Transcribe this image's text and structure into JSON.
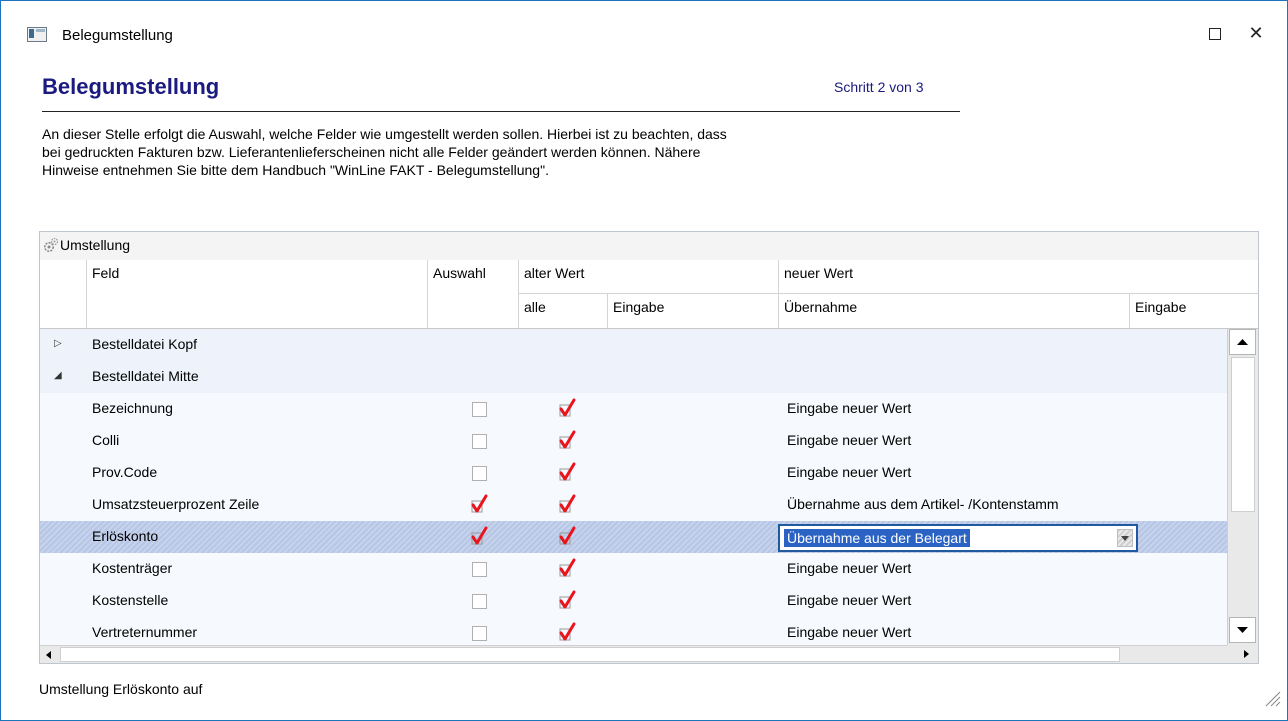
{
  "window": {
    "title": "Belegumstellung"
  },
  "header": {
    "title": "Belegumstellung",
    "step": "Schritt 2 von 3",
    "intro_lines": [
      "An dieser Stelle erfolgt die Auswahl, welche Felder wie umgestellt werden sollen. Hierbei ist zu beachten, dass",
      "bei gedruckten Fakturen bzw. Lieferantenlieferscheinen nicht alle Felder geändert werden können. Nähere",
      "Hinweise entnehmen Sie bitte dem Handbuch \"WinLine FAKT - Belegumstellung\"."
    ]
  },
  "grid": {
    "title": "Umstellung",
    "columns": {
      "feld": "Feld",
      "auswahl": "Auswahl",
      "alter_wert": "alter Wert",
      "alle": "alle",
      "eingabe_alt": "Eingabe",
      "neuer_wert": "neuer Wert",
      "uebernahme": "Übernahme",
      "eingabe_neu": "Eingabe"
    },
    "rows": [
      {
        "type": "group",
        "label": "Bestelldatei Kopf",
        "expanded": false
      },
      {
        "type": "group",
        "label": "Bestelldatei Mitte",
        "expanded": true
      },
      {
        "type": "item",
        "label": "Bezeichnung",
        "auswahl": false,
        "alle": true,
        "uebernahme": "Eingabe neuer Wert"
      },
      {
        "type": "item",
        "label": "Colli",
        "auswahl": false,
        "alle": true,
        "uebernahme": "Eingabe neuer Wert"
      },
      {
        "type": "item",
        "label": "Prov.Code",
        "auswahl": false,
        "alle": true,
        "uebernahme": "Eingabe neuer Wert"
      },
      {
        "type": "item",
        "label": "Umsatzsteuerprozent Zeile",
        "auswahl": true,
        "alle": true,
        "uebernahme": "Übernahme aus dem Artikel- /Kontenstamm"
      },
      {
        "type": "item",
        "label": "Erlöskonto",
        "auswahl": true,
        "alle": true,
        "uebernahme": "Übernahme aus der Belegart",
        "selected": true
      },
      {
        "type": "item",
        "label": "Kostenträger",
        "auswahl": false,
        "alle": true,
        "uebernahme": "Eingabe neuer Wert"
      },
      {
        "type": "item",
        "label": "Kostenstelle",
        "auswahl": false,
        "alle": true,
        "uebernahme": "Eingabe neuer Wert"
      },
      {
        "type": "item",
        "label": "Vertreternummer",
        "auswahl": false,
        "alle": true,
        "uebernahme": "Eingabe neuer Wert"
      }
    ]
  },
  "status": {
    "text": "Umstellung Erlöskonto auf"
  },
  "colors": {
    "accent": "#1a1a80",
    "selection": "#2a63c4",
    "check": "#e8141e"
  }
}
